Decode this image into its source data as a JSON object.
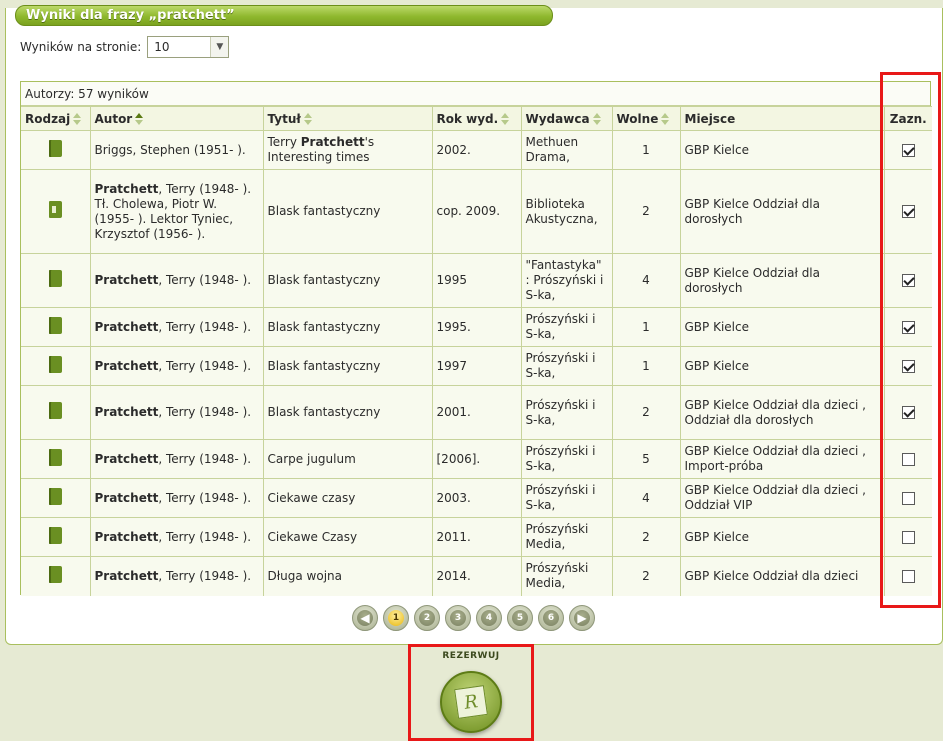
{
  "header": {
    "title": "Wyniki dla frazy „pratchett”"
  },
  "per_page": {
    "label": "Wyników na stronie:",
    "value": "10"
  },
  "summary": "Autorzy: 57 wyników",
  "columns": {
    "type": "Rodzaj",
    "author": "Autor",
    "title": "Tytuł",
    "year": "Rok wyd.",
    "publisher": "Wydawca",
    "free": "Wolne",
    "place": "Miejsce",
    "select": "Zazn."
  },
  "rows": [
    {
      "icon": "book-icon",
      "author_bold": "",
      "author_rest": "Briggs, Stephen (1951- ).",
      "title_pre": "Terry ",
      "title_bold": "Pratchett",
      "title_post": "'s Interesting times",
      "year": "2002.",
      "publisher": "Methuen Drama,",
      "free": "1",
      "place": "GBP Kielce",
      "checked": true
    },
    {
      "icon": "audiobook-icon",
      "author_bold": "Pratchett",
      "author_rest": ", Terry (1948- ). Tł. Cholewa, Piotr W. (1955- ). Lektor Tyniec, Krzysztof (1956- ).",
      "title_pre": "Blask fantastyczny",
      "title_bold": "",
      "title_post": "",
      "year": "cop. 2009.",
      "publisher": "Biblioteka Akustyczna,",
      "free": "2",
      "place": "GBP Kielce Oddział dla dorosłych",
      "checked": true
    },
    {
      "icon": "book-icon",
      "author_bold": "Pratchett",
      "author_rest": ", Terry (1948- ).",
      "title_pre": "Blask fantastyczny",
      "title_bold": "",
      "title_post": "",
      "year": "1995",
      "publisher": "\"Fantastyka\" : Prószyński i S-ka,",
      "free": "4",
      "place": "GBP Kielce Oddział dla dorosłych",
      "checked": true
    },
    {
      "icon": "book-icon",
      "author_bold": "Pratchett",
      "author_rest": ", Terry (1948- ).",
      "title_pre": "Blask fantastyczny",
      "title_bold": "",
      "title_post": "",
      "year": "1995.",
      "publisher": "Prószyński i S-ka,",
      "free": "1",
      "place": "GBP Kielce",
      "checked": true
    },
    {
      "icon": "book-icon",
      "author_bold": "Pratchett",
      "author_rest": ", Terry (1948- ).",
      "title_pre": "Blask fantastyczny",
      "title_bold": "",
      "title_post": "",
      "year": "1997",
      "publisher": "Prószyński i S-ka,",
      "free": "1",
      "place": "GBP Kielce",
      "checked": true
    },
    {
      "icon": "book-icon",
      "author_bold": "Pratchett",
      "author_rest": ", Terry (1948- ).",
      "title_pre": "Blask fantastyczny",
      "title_bold": "",
      "title_post": "",
      "year": "2001.",
      "publisher": "Prószyński i S-ka,",
      "free": "2",
      "place": "GBP Kielce Oddział dla dzieci , Oddział dla dorosłych",
      "checked": true
    },
    {
      "icon": "book-icon",
      "author_bold": "Pratchett",
      "author_rest": ", Terry (1948- ).",
      "title_pre": "Carpe jugulum",
      "title_bold": "",
      "title_post": "",
      "year": "[2006].",
      "publisher": "Prószyński i S-ka,",
      "free": "5",
      "place": "GBP Kielce Oddział dla dzieci , Import-próba",
      "checked": false
    },
    {
      "icon": "book-icon",
      "author_bold": "Pratchett",
      "author_rest": ", Terry (1948- ).",
      "title_pre": "Ciekawe czasy",
      "title_bold": "",
      "title_post": "",
      "year": "2003.",
      "publisher": "Prószyński i S-ka,",
      "free": "4",
      "place": "GBP Kielce Oddział dla dzieci , Oddział VIP",
      "checked": false
    },
    {
      "icon": "book-icon",
      "author_bold": "Pratchett",
      "author_rest": ", Terry (1948- ).",
      "title_pre": "Ciekawe Czasy",
      "title_bold": "",
      "title_post": "",
      "year": "2011.",
      "publisher": "Prószyński Media,",
      "free": "2",
      "place": "GBP Kielce",
      "checked": false
    },
    {
      "icon": "book-icon",
      "author_bold": "Pratchett",
      "author_rest": ", Terry (1948- ).",
      "title_pre": "Długa wojna",
      "title_bold": "",
      "title_post": "",
      "year": "2014.",
      "publisher": "Prószyński Media,",
      "free": "2",
      "place": "GBP Kielce Oddział dla dzieci",
      "checked": false
    }
  ],
  "pagination": {
    "prev_icon": "chevron-left-icon",
    "next_icon": "chevron-right-icon",
    "pages": [
      "1",
      "2",
      "3",
      "4",
      "5",
      "6"
    ],
    "current": "1"
  },
  "reserve": {
    "label": "REZERWUJ",
    "icon": "reserve-card-icon",
    "glyph": "R"
  },
  "highlight_color": "#e81818",
  "accent_color": "#8fb82e"
}
